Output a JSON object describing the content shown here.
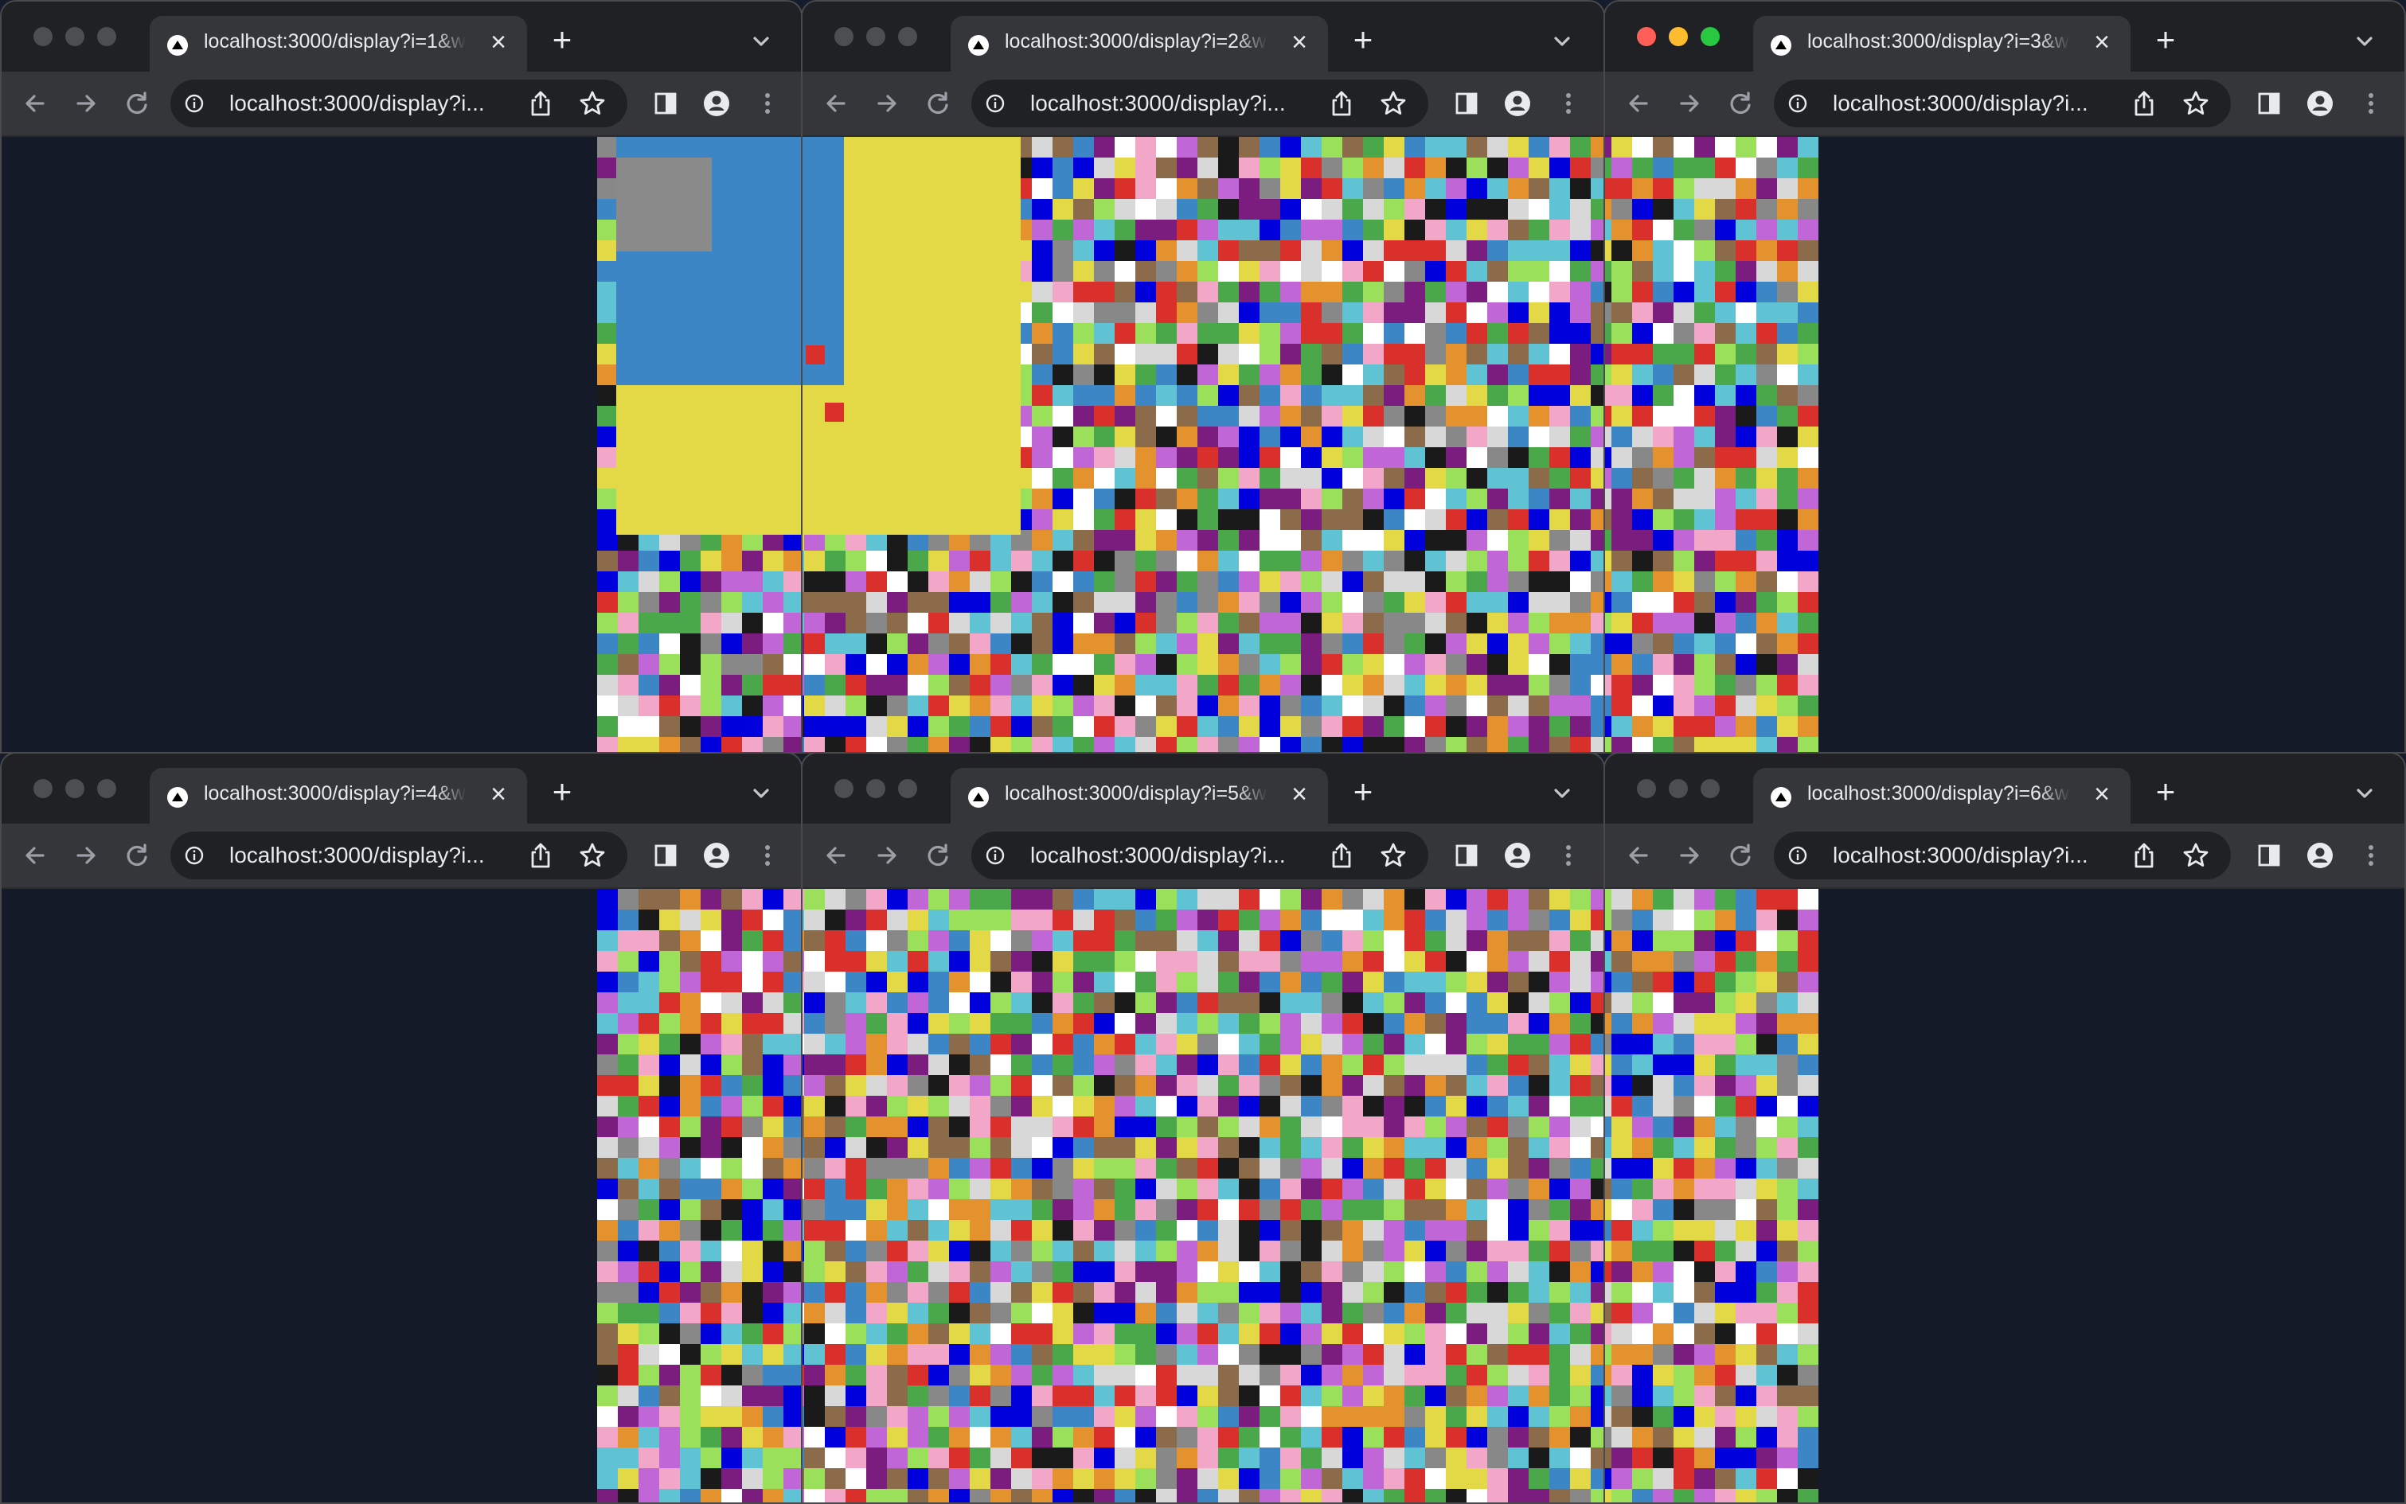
{
  "windows": [
    {
      "tab_title": "localhost:3000/display?i=1&w=",
      "url": "localhost:3000/display?i...",
      "active": false
    },
    {
      "tab_title": "localhost:3000/display?i=2&w=",
      "url": "localhost:3000/display?i...",
      "active": false
    },
    {
      "tab_title": "localhost:3000/display?i=3&w=",
      "url": "localhost:3000/display?i...",
      "active": true
    },
    {
      "tab_title": "localhost:3000/display?i=4&w=",
      "url": "localhost:3000/display?i...",
      "active": false
    },
    {
      "tab_title": "localhost:3000/display?i=5&w=",
      "url": "localhost:3000/display?i...",
      "active": false
    },
    {
      "tab_title": "localhost:3000/display?i=6&w=",
      "url": "localhost:3000/display?i...",
      "active": false
    }
  ],
  "colors": {
    "desktop_background": "#141a28",
    "tab_strip": "#202124",
    "toolbar": "#35363a",
    "mosaic_blue": "#3d86c6",
    "mosaic_yellow": "#e3d846",
    "mosaic_gray": "#8a8a8a",
    "mosaic_red": "#d9302c",
    "palette": [
      "#f2a6c8",
      "#5fc3d4",
      "#1a1a1a",
      "#ffffff",
      "#e3d846",
      "#9be05b",
      "#c166d6",
      "#7b1c7f",
      "#d9302c",
      "#e3922e",
      "#3d86c6",
      "#0000dd",
      "#8c6b4a",
      "#888888",
      "#d8d8d8",
      "#4aa84a"
    ]
  },
  "icons": [
    "traffic-lights",
    "favicon-triangle",
    "close-icon",
    "plus-icon",
    "chevron-down-icon",
    "back-arrow-icon",
    "forward-arrow-icon",
    "reload-icon",
    "info-icon",
    "share-icon",
    "star-icon",
    "side-panel-icon",
    "profile-icon",
    "kebab-menu-icon"
  ]
}
